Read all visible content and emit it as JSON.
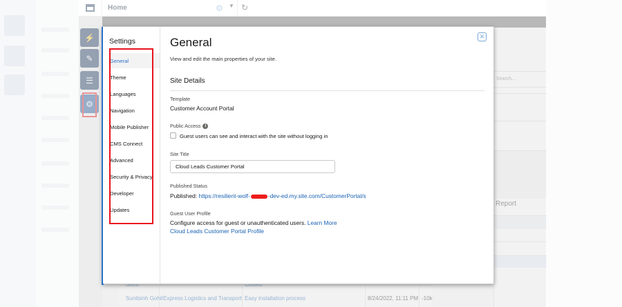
{
  "topbar": {
    "page_title": "Home"
  },
  "modal": {
    "nav_title": "Settings",
    "nav_items": [
      {
        "label": "General"
      },
      {
        "label": "Theme"
      },
      {
        "label": "Languages"
      },
      {
        "label": "Navigation"
      },
      {
        "label": "Mobile Publisher"
      },
      {
        "label": "CMS Connect"
      },
      {
        "label": "Advanced"
      },
      {
        "label": "Security & Privacy"
      },
      {
        "label": "Developer"
      },
      {
        "label": "Updates"
      }
    ],
    "active_nav": "General",
    "close_glyph": "✕",
    "heading": "General",
    "description": "View and edit the main properties of your site.",
    "section_title": "Site Details",
    "template": {
      "label": "Template",
      "value": "Customer Account Portal"
    },
    "public_access": {
      "label": "Public Access",
      "info_glyph": "i",
      "checkbox_label": "Guest users can see and interact with the site without logging in",
      "checked": false
    },
    "site_title": {
      "label": "Site Title",
      "value": "Cloud Leads Customer Portal"
    },
    "published_status": {
      "label": "Published Status",
      "prefix": "Published:",
      "url_start": "https://resilient-wolf-",
      "url_end": "-dev-ed.my.site.com/CustomerPortal/s"
    },
    "guest_profile": {
      "label": "Guest User Profile",
      "text": "Configure access for guest or unauthenticated users.",
      "learn_more": "Learn More",
      "profile_link": "Cloud Leads Customer Portal Profile"
    }
  },
  "background": {
    "search_placeholder": "Search...",
    "report_label": "Report",
    "table_row": {
      "name_top": "Gohil",
      "name": "Sunilsinh Gohil",
      "company": "Express Logistics and Transport",
      "subject_top": "Closed",
      "subject": "Easy installation process",
      "date": "8/24/2022, 11:11 PM",
      "amount": "-10k"
    }
  },
  "colors": {
    "accent": "#2b71c9",
    "rail_dark": "#16325c",
    "highlight_red": "#e8141c"
  },
  "icons": {
    "rail": [
      "lightning-icon",
      "brush-icon",
      "list-icon",
      "gear-icon"
    ]
  }
}
